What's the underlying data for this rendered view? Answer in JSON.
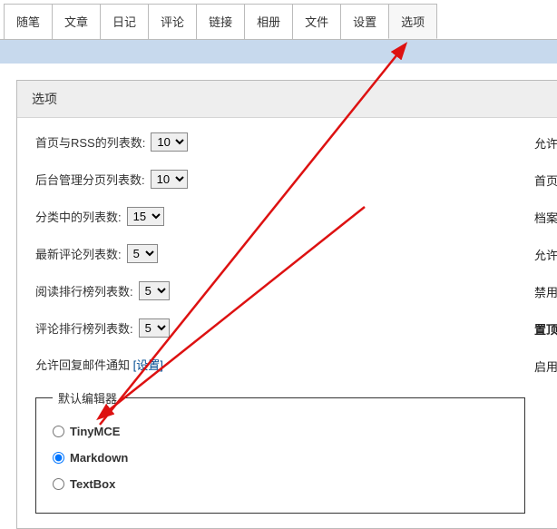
{
  "tabs": {
    "items": [
      "随笔",
      "文章",
      "日记",
      "评论",
      "链接",
      "相册",
      "文件",
      "设置",
      "选项"
    ],
    "activeIndex": 8
  },
  "panel": {
    "title": "选项"
  },
  "fields": {
    "homeRss": {
      "label": "首页与RSS的列表数:",
      "value": "10"
    },
    "adminPage": {
      "label": "后台管理分页列表数:",
      "value": "10"
    },
    "category": {
      "label": "分类中的列表数:",
      "value": "15"
    },
    "recentCmt": {
      "label": "最新评论列表数:",
      "value": "5"
    },
    "readRank": {
      "label": "阅读排行榜列表数:",
      "value": "5"
    },
    "cmtRank": {
      "label": "评论排行榜列表数:",
      "value": "5"
    }
  },
  "sideLinks": {
    "allow": "允许",
    "home": "首页",
    "archive": "档案",
    "allow2": "允许",
    "disable": "禁用",
    "top": "置顶",
    "enable": "启用"
  },
  "notify": {
    "text": "允许回复邮件通知",
    "linkText": "[设置]"
  },
  "editor": {
    "legend": "默认编辑器",
    "options": {
      "tinymce": "TinyMCE",
      "markdown": "Markdown",
      "textbox": "TextBox"
    },
    "selected": "markdown"
  }
}
